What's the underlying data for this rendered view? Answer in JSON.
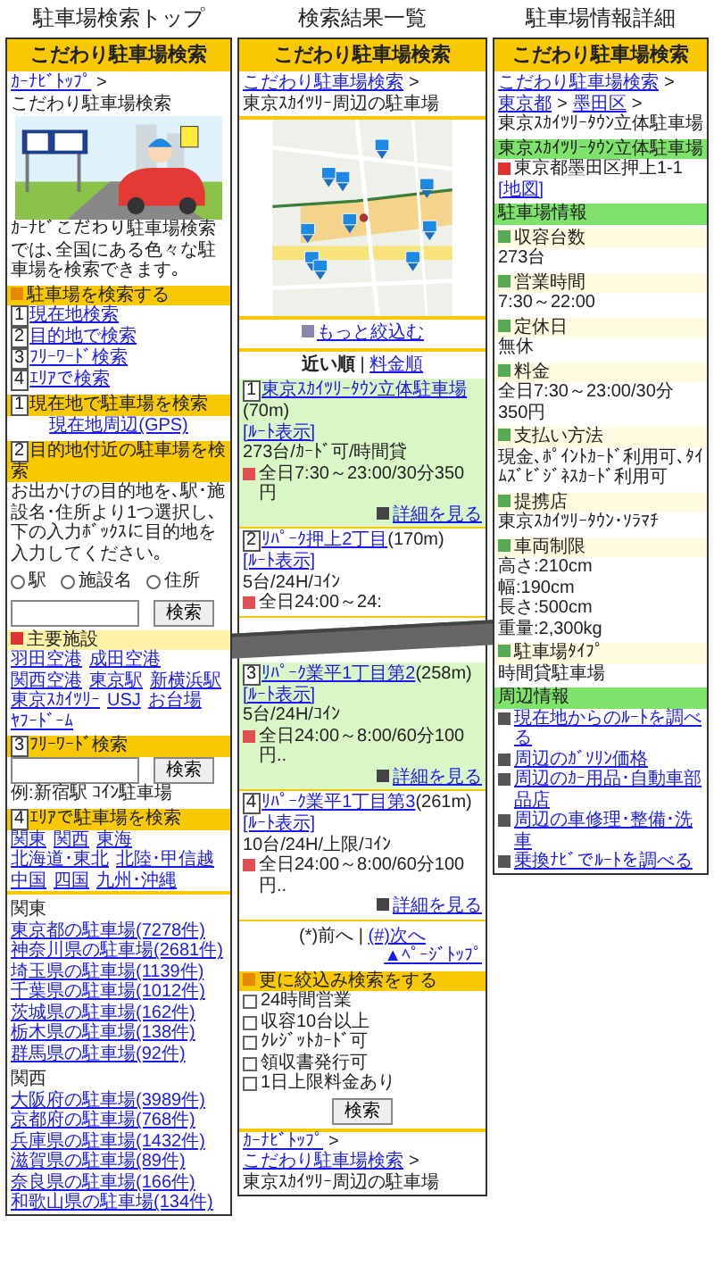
{
  "top": {
    "title": "駐車場検索トップ",
    "header": "こだわり駐車場検索",
    "separator": ">",
    "breadcrumb": [
      {
        "text": "ｶｰﾅﾋﾞﾄｯﾌﾟ",
        "link": true
      },
      {
        "text": "こだわり駐車場検索",
        "link": false
      }
    ],
    "intro": "ｶｰﾅﾋﾞこだわり駐車場検索では､全国にある色々な駐車場を検索できます｡",
    "search_heading": "駐車場を検索する",
    "menu_links": [
      {
        "num": "1",
        "text": "現在地検索"
      },
      {
        "num": "2",
        "text": "目的地で検索"
      },
      {
        "num": "3",
        "text": "ﾌﾘｰﾜｰﾄﾞ検索"
      },
      {
        "num": "4",
        "text": "ｴﾘｱで検索"
      }
    ],
    "gps": {
      "num": "1",
      "heading": "現在地で駐車場を検索",
      "link": "現在地周辺(GPS)"
    },
    "destination": {
      "num": "2",
      "heading": "目的地付近の駐車場を検索",
      "description": "お出かけの目的地を､駅･施設名･住所より1つ選択し､下の入力ﾎﾞｯｸｽに目的地を入力してください｡",
      "options": [
        {
          "label": "駅",
          "selected": false
        },
        {
          "label": "施設名",
          "selected": false
        },
        {
          "label": "住所",
          "selected": false
        }
      ],
      "button": "検索"
    },
    "facilities": {
      "heading": "主要施設",
      "links": [
        "羽田空港",
        "成田空港",
        "関西空港",
        "東京駅",
        "新横浜駅",
        "東京ｽｶｲﾂﾘｰ",
        "USJ",
        "お台場",
        "ﾔﾌｰﾄﾞｰﾑ"
      ]
    },
    "freeword": {
      "num": "3",
      "heading": "ﾌﾘｰﾜｰﾄﾞ検索",
      "button": "検索",
      "example": "例:新宿駅 ｺｲﾝ駐車場"
    },
    "area": {
      "num": "4",
      "heading": "ｴﾘｱで駐車場を検索",
      "regions": [
        "関東",
        "関西",
        "東海",
        "北海道･東北",
        "北陸･甲信越",
        "中国",
        "四国",
        "九州･沖縄"
      ],
      "groups": [
        {
          "name": "関東",
          "links": [
            "東京都の駐車場(7278件)",
            "神奈川県の駐車場(2681件)",
            "埼玉県の駐車場(1139件)",
            "千葉県の駐車場(1012件)",
            "茨城県の駐車場(162件)",
            "栃木県の駐車場(138件)",
            "群馬県の駐車場(92件)"
          ]
        },
        {
          "name": "関西",
          "links": [
            "大阪府の駐車場(3989件)",
            "京都府の駐車場(768件)",
            "兵庫県の駐車場(1432件)",
            "滋賀県の駐車場(89件)",
            "奈良県の駐車場(166件)",
            "和歌山県の駐車場(134件)"
          ]
        }
      ]
    }
  },
  "results": {
    "title": "検索結果一覧",
    "header": "こだわり駐車場検索",
    "separator": ">",
    "breadcrumb": [
      {
        "text": "こだわり駐車場検索",
        "link": true
      },
      {
        "text": "東京ｽｶｲﾂﾘｰ周辺の駐車場",
        "link": false
      }
    ],
    "refine_link": "もっと絞込む",
    "sort": [
      {
        "text": "近い順",
        "selected": true
      },
      {
        "text": "料金順",
        "selected": false
      }
    ],
    "sort_separator": "|",
    "items": [
      {
        "kind": "result",
        "num": "1",
        "name": "東京ｽｶｲﾂﾘｰﾀｳﾝ立体駐車場",
        "distance": "(70m)",
        "route": "[ﾙｰﾄ表示]",
        "spec": "273台/ｶｰﾄﾞ可/時間貸",
        "price": "全日7:30～23:00/30分350円",
        "detail": "詳細を見る",
        "highlighted": true
      },
      {
        "kind": "result",
        "num": "2",
        "name": "ﾘﾊﾟｰｸ押上2丁目",
        "distance": "(170m)",
        "route": "[ﾙｰﾄ表示]",
        "spec": "5台/24H/ｺｲﾝ",
        "price": "全日24:00～24:",
        "highlighted": false
      },
      {
        "kind": "omission"
      },
      {
        "kind": "result",
        "num": "3",
        "name": "ﾘﾊﾟｰｸ業平1丁目第2",
        "distance": "(258m)",
        "route": "[ﾙｰﾄ表示]",
        "spec": "5台/24H/ｺｲﾝ",
        "price": "全日24:00～8:00/60分100円..",
        "detail": "詳細を見る",
        "highlighted": true
      },
      {
        "kind": "result",
        "num": "4",
        "name": "ﾘﾊﾟｰｸ業平1丁目第3",
        "distance": "(261m)",
        "route": "[ﾙｰﾄ表示]",
        "spec": "10台/24H/上限/ｺｲﾝ",
        "price": "全日24:00～8:00/60分100円..",
        "detail": "詳細を見る",
        "highlighted": false
      }
    ],
    "pager": {
      "prev": "(*)前へ",
      "separator": "|",
      "next": "(#)次へ",
      "page_top": "▲ﾍﾟｰｼﾞﾄｯﾌﾟ"
    },
    "refine": {
      "heading": "更に絞込み検索をする",
      "options": [
        {
          "label": "24時間営業",
          "checked": false
        },
        {
          "label": "収容10台以上",
          "checked": false
        },
        {
          "label": "ｸﾚｼﾞｯﾄｶｰﾄﾞ可",
          "checked": false
        },
        {
          "label": "領収書発行可",
          "checked": false
        },
        {
          "label": "1日上限料金あり",
          "checked": false
        }
      ],
      "button": "検索"
    },
    "footer_breadcrumb": [
      {
        "text": "ｶｰﾅﾋﾞﾄｯﾌﾟ",
        "link": true
      },
      {
        "text": "こだわり駐車場検索",
        "link": true
      },
      {
        "text": "東京ｽｶｲﾂﾘｰ周辺の駐車場",
        "link": false
      }
    ]
  },
  "detail": {
    "title": "駐車場情報詳細",
    "header": "こだわり駐車場検索",
    "separator": ">",
    "breadcrumb": [
      {
        "text": "こだわり駐車場検索",
        "link": true
      },
      {
        "text": "東京都",
        "link": true
      },
      {
        "text": "墨田区",
        "link": true
      },
      {
        "text": "東京ｽｶｲﾂﾘｰﾀｳﾝ立体駐車場",
        "link": false
      }
    ],
    "name": "東京ｽｶｲﾂﾘｰﾀｳﾝ立体駐車場",
    "address": "東京都墨田区押上1-1",
    "map_link": "[地図]",
    "info_heading": "駐車場情報",
    "fields": [
      {
        "label": "収容台数",
        "lines": [
          "273台"
        ]
      },
      {
        "label": "営業時間",
        "lines": [
          "7:30～22:00"
        ]
      },
      {
        "label": "定休日",
        "lines": [
          "無休"
        ]
      },
      {
        "label": "料金",
        "lines": [
          "全日7:30～23:00/30分350円"
        ]
      },
      {
        "label": "支払い方法",
        "lines": [
          "現金､ﾎﾟｲﾝﾄｶｰﾄﾞ利用可､ﾀｲﾑｽﾞﾋﾞｼﾞﾈｽｶｰﾄﾞ利用可"
        ]
      },
      {
        "label": "提携店",
        "lines": [
          "東京ｽｶｲﾂﾘｰﾀｳﾝ･ｿﾗﾏﾁ"
        ]
      },
      {
        "label": "車両制限",
        "lines": [
          "高さ:210cm",
          "幅:190cm",
          "長さ:500cm",
          "重量:2,300kg"
        ]
      },
      {
        "label": "駐車場ﾀｲﾌﾟ",
        "lines": [
          "時間貸駐車場"
        ]
      }
    ],
    "nearby_heading": "周辺情報",
    "nearby_links": [
      "現在地からのﾙｰﾄを調べる",
      "周辺のｶﾞｿﾘﾝ価格",
      "周辺のｶｰ用品･自動車部品店",
      "周辺の車修理･整備･洗車",
      "乗換ﾅﾋﾞでﾙｰﾄを調べる"
    ]
  }
}
